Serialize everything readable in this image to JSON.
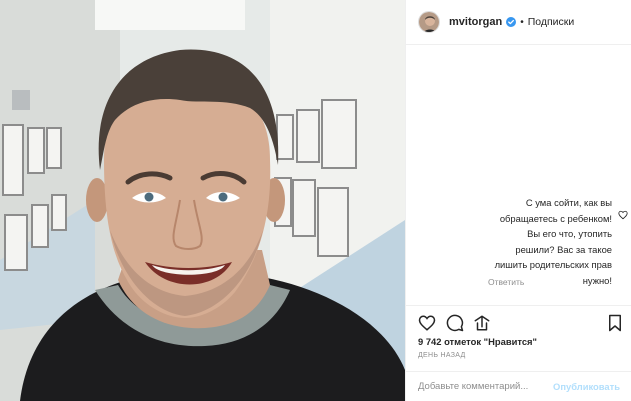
{
  "post": {
    "username": "mvitorgan",
    "separator": "•",
    "follow_label": "Подписки"
  },
  "comment": {
    "text": "С ума сойти, как вы обращаетесь с ребенком! Вы его что, утопить решили? Вас за такое лишить родительских прав нужно!",
    "reply_label": "Ответить"
  },
  "likes": {
    "text": "9 742 отметок \"Нравится\""
  },
  "time_ago": "День назад",
  "add_comment": {
    "placeholder": "Добавьте комментарий...",
    "publish_label": "Опубликовать"
  },
  "icons": {
    "verified": "verified-badge-icon",
    "like": "heart-icon",
    "comment": "comment-icon",
    "share": "share-icon",
    "save": "bookmark-icon"
  },
  "colors": {
    "verified_blue": "#3897f0",
    "publish_disabled": "#b2dffc",
    "muted_text": "#8e8e8e"
  }
}
